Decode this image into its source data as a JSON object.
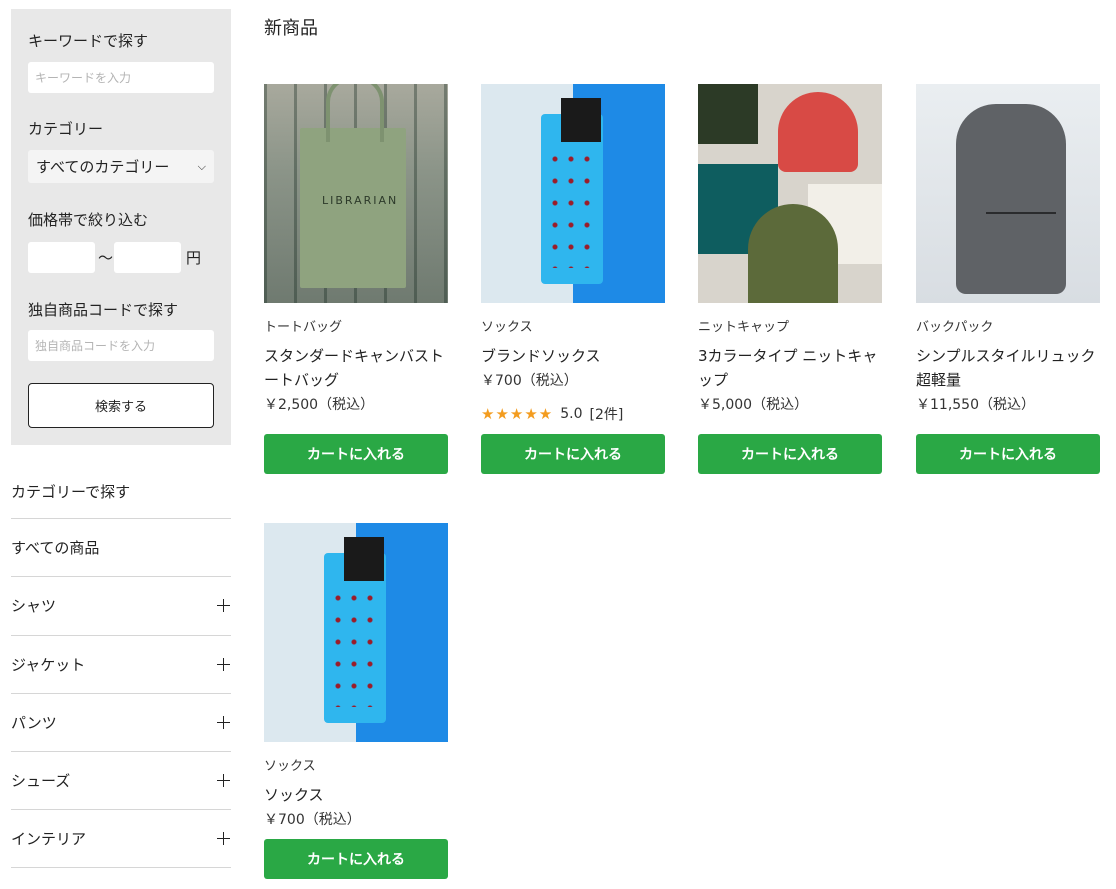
{
  "search": {
    "keyword_label": "キーワードで探す",
    "keyword_placeholder": "キーワードを入力",
    "category_label": "カテゴリー",
    "category_selected": "すべてのカテゴリー",
    "price_label": "価格帯で絞り込む",
    "price_separator": "～",
    "price_unit": "円",
    "code_label": "独自商品コードで探す",
    "code_placeholder": "独自商品コードを入力",
    "submit_label": "検索する"
  },
  "categories": {
    "heading": "カテゴリーで探す",
    "items": [
      {
        "label": "すべての商品"
      },
      {
        "label": "シャツ"
      },
      {
        "label": "ジャケット"
      },
      {
        "label": "パンツ"
      },
      {
        "label": "シューズ"
      },
      {
        "label": "インテリア"
      }
    ]
  },
  "main": {
    "title": "新商品",
    "products": [
      {
        "category": "トートバッグ",
        "name": "スタンダードキャンバストートバッグ",
        "price": "￥2,500（税込）",
        "button": "カートに入れる",
        "image_text": "LIBRARIAN"
      },
      {
        "category": "ソックス",
        "name": "ブランドソックス",
        "price": "￥700（税込）",
        "rating_stars": "★★★★★",
        "rating_value": "5.0",
        "rating_count": "[2件]",
        "button": "カートに入れる"
      },
      {
        "category": "ニットキャップ",
        "name": "3カラータイプ ニットキャップ",
        "price": "￥5,000（税込）",
        "button": "カートに入れる"
      },
      {
        "category": "バックパック",
        "name": "シンプルスタイルリュック超軽量",
        "price": "￥11,550（税込）",
        "button": "カートに入れる"
      },
      {
        "category": "ソックス",
        "name": "ソックス",
        "price": "￥700（税込）",
        "button": "カートに入れる"
      }
    ]
  }
}
